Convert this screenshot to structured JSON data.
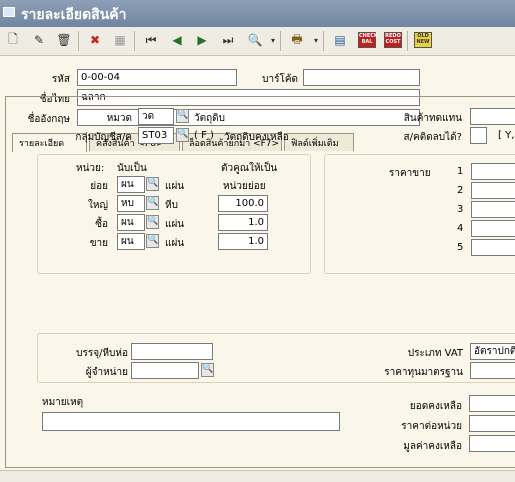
{
  "window": {
    "title": "รายละเอียดสินค้า"
  },
  "toolbar": [
    {
      "name": "new-doc-icon",
      "glyph": "🗋"
    },
    {
      "name": "edit-doc-icon",
      "glyph": "✎"
    },
    {
      "name": "delete-bin-icon",
      "glyph": "🗑"
    },
    {
      "name": "cancel-icon",
      "glyph": "✖"
    },
    {
      "name": "save-disk-icon",
      "glyph": "▦"
    },
    {
      "name": "first-record-icon",
      "glyph": "⏮"
    },
    {
      "name": "prev-record-icon",
      "glyph": "◀"
    },
    {
      "name": "next-record-icon",
      "glyph": "▶"
    },
    {
      "name": "last-record-icon",
      "glyph": "⏭"
    },
    {
      "name": "search-icon",
      "glyph": "🔍"
    },
    {
      "name": "print-icon",
      "glyph": "🖶"
    },
    {
      "name": "calculator-icon",
      "glyph": "▤"
    }
  ],
  "toolbar_tags": {
    "check_bal": "CHECK BAL",
    "redo_cost": "REDO COST",
    "old_new": "OLD NEW"
  },
  "header": {
    "code_label": "รหัส",
    "code_value": "0-00-04",
    "barcode_label": "บาร์โค้ด",
    "barcode_value": "",
    "thai_name_label": "ชื่อไทย",
    "thai_name_value": "ฉลาก",
    "eng_name_label": "ชื่ออังกฤษ",
    "eng_name_value": ""
  },
  "tabs": [
    "รายละเอียด",
    "คลังสินค้า <F8>",
    "ล็อตสินค้ายกมา <F7>",
    "ฟิลด์เพิ่มเติม"
  ],
  "detail": {
    "category_label": "หมวด",
    "category_value": "วด",
    "category_desc": "วัตถุดิบ",
    "account_group_label": "กลุ่มบัญชีส/ค",
    "account_group_value": "ST03",
    "account_group_flag": "( F )",
    "account_group_desc": "วัตถุดิบคงเหลือ",
    "substitute_label": "สินค้าทดแทน",
    "substitute_value": "",
    "deductible_label": "ส/คติดลบได้?",
    "deductible_value": "",
    "deductible_hint": "[ Y,",
    "unit": {
      "header_unit": "หน่วย:",
      "header_count": "นับเป็น",
      "header_multiplier": "ตัวคูณให้เป็น",
      "header_small_unit": "หน่วยย่อย",
      "rows": [
        {
          "label": "ย่อย",
          "code": "ผน",
          "name": "แผ่น",
          "multiplier": ""
        },
        {
          "label": "ใหญ่",
          "code": "หบ",
          "name": "หีบ",
          "multiplier": "100.0"
        },
        {
          "label": "ซื้อ",
          "code": "ผน",
          "name": "แผ่น",
          "multiplier": "1.0"
        },
        {
          "label": "ขาย",
          "code": "ผน",
          "name": "แผ่น",
          "multiplier": "1.0"
        }
      ]
    },
    "price": {
      "label": "ราคาขาย",
      "levels": [
        "1",
        "2",
        "3",
        "4",
        "5"
      ]
    },
    "packing_label": "บรรจุ/หีบห่อ",
    "packing_value": "",
    "supplier_label": "ผู้จำหน่าย",
    "supplier_value": "",
    "vat_label": "ประเภท VAT",
    "vat_value": "อัตราปกติ",
    "std_cost_label": "ราคาทุนมาตรฐาน",
    "std_cost_value": "",
    "note_label": "หมายเหตุ",
    "note_value": "",
    "balance_label": "ยอดคงเหลือ",
    "balance_value": "",
    "unit_cost_label": "ราคาต่อหน่วย",
    "unit_cost_value": "",
    "remaining_value_label": "มูลค่าคงเหลือ",
    "remaining_value_value": ""
  }
}
